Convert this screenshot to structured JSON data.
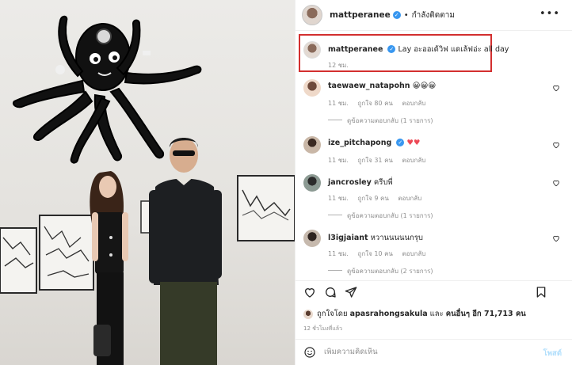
{
  "post": {
    "username": "mattperanee",
    "follow_status": "กำลังติดตาม",
    "more": "•••"
  },
  "caption": {
    "username": "mattperanee",
    "text": "Lay อะออเด้วิฟ แดเล้ฟอ่ะ all day",
    "time": "12 ชม."
  },
  "comments": [
    {
      "username": "taewaew_natapohn",
      "text": "😀😀😀",
      "verified": false,
      "time": "11 ชม.",
      "likes": "ถูกใจ 80 คน",
      "reply": "ตอบกลับ",
      "replies": "ดูข้อความตอบกลับ (1 รายการ)"
    },
    {
      "username": "ize_pitchapong",
      "text": "♥♥",
      "verified": true,
      "time": "11 ชม.",
      "likes": "ถูกใจ 31 คน",
      "reply": "ตอบกลับ",
      "replies": ""
    },
    {
      "username": "jancrosley",
      "text": "ครีบพี่",
      "verified": false,
      "time": "11 ชม.",
      "likes": "ถูกใจ 9 คน",
      "reply": "ตอบกลับ",
      "replies": "ดูข้อความตอบกลับ (1 รายการ)"
    },
    {
      "username": "l3igjaiant",
      "text": "หวานนนนนกรุบ",
      "verified": false,
      "time": "11 ชม.",
      "likes": "ถูกใจ 10 คน",
      "reply": "ตอบกลับ",
      "replies": "ดูข้อความตอบกลับ (2 รายการ)"
    }
  ],
  "likes_line": {
    "prefix": "ถูกใจโดย",
    "user": "apasrahongsakula",
    "and": "และ",
    "others": "คนอื่นๆ อีก 71,713 คน"
  },
  "post_time": "12 ชั่วโมงที่แล้ว",
  "add_comment": {
    "placeholder": "เพิ่มความคิดเห็น",
    "post_label": "โพสต์"
  },
  "colors": {
    "verified": "#3897f0",
    "highlight_border": "#d32f2f",
    "heart_red": "#ed4956",
    "muted_text": "#8e8e8e"
  },
  "icons": [
    "more-icon",
    "heart-icon",
    "comment-icon",
    "share-icon",
    "bookmark-icon",
    "emoji-icon",
    "verified-badge"
  ]
}
